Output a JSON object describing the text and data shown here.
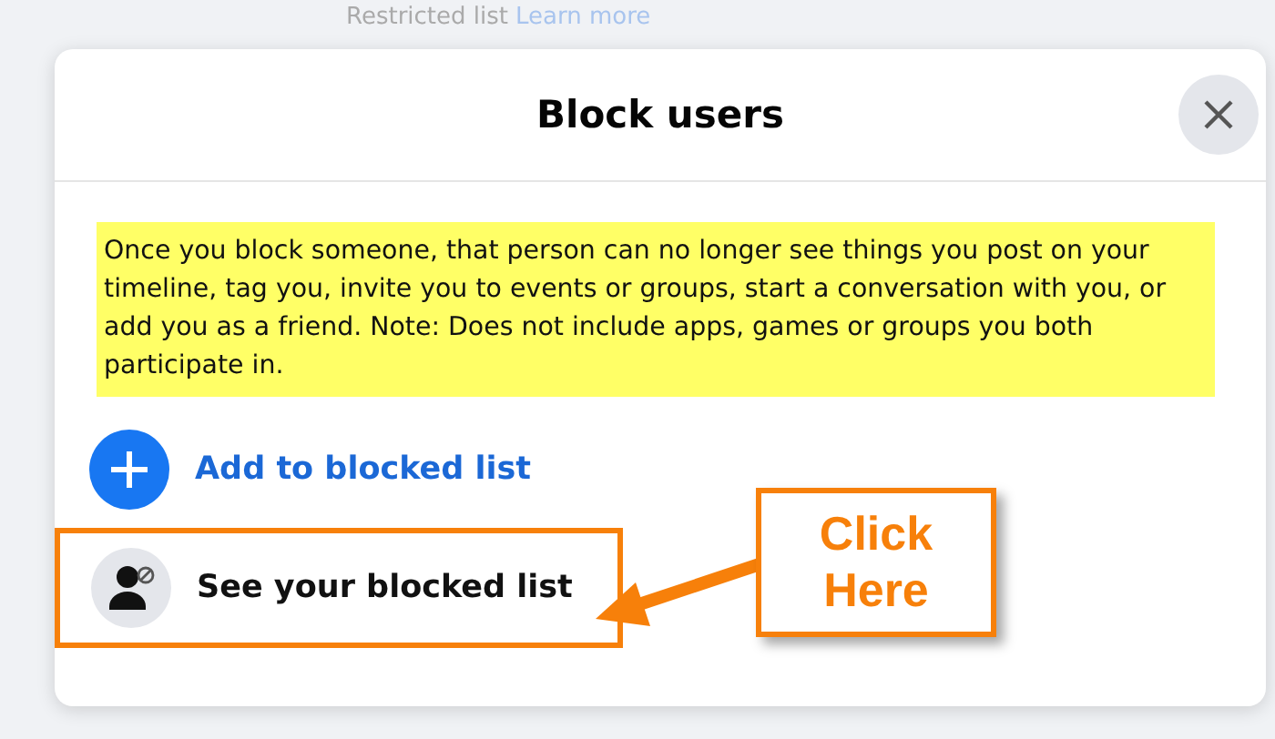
{
  "background": {
    "text": "Restricted list",
    "link": "Learn more"
  },
  "dialog": {
    "title": "Block users",
    "note": "Once you block someone, that person can no longer see things you post on your timeline, tag you, invite you to events or groups, start a conversation with you, or add you as a friend. Note: Does not include apps, games or groups you both participate in.",
    "actions": [
      {
        "kind": "add",
        "label": "Add to blocked list",
        "highlighted": false
      },
      {
        "kind": "list",
        "label": "See your blocked list",
        "highlighted": true
      }
    ]
  },
  "callout": {
    "text": "Click Here"
  }
}
